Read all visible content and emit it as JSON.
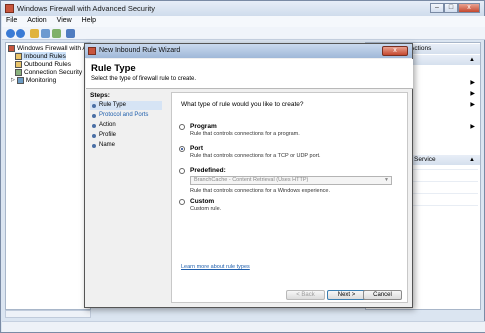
{
  "window": {
    "title": "Windows Firewall with Advanced Security",
    "minimize": "–",
    "maximize": "□",
    "close": "x"
  },
  "menubar": [
    "File",
    "Action",
    "View",
    "Help"
  ],
  "toolbar": [
    "back-icon",
    "forward-icon",
    "up-icon",
    "properties-icon",
    "refresh-icon",
    "help-icon"
  ],
  "tree": {
    "root": "Windows Firewall with Adva",
    "items": [
      "Inbound Rules",
      "Outbound Rules",
      "Connection Security Ru",
      "Monitoring"
    ]
  },
  "actions_pane": {
    "header": "Actions",
    "section2": "Service"
  },
  "wizard": {
    "title": "New Inbound Rule Wizard",
    "close": "x",
    "heading": "Rule Type",
    "subheading": "Select the type of firewall rule to create.",
    "steps_label": "Steps:",
    "steps": [
      {
        "label": "Rule Type",
        "state": "current"
      },
      {
        "label": "Protocol and Ports",
        "state": "next"
      },
      {
        "label": "Action",
        "state": "pending"
      },
      {
        "label": "Profile",
        "state": "pending"
      },
      {
        "label": "Name",
        "state": "pending"
      }
    ],
    "question": "What type of rule would you like to create?",
    "options": [
      {
        "label": "Program",
        "desc": "Rule that controls connections for a program.",
        "checked": false
      },
      {
        "label": "Port",
        "desc": "Rule that controls connections for a TCP or UDP port.",
        "checked": true
      },
      {
        "label": "Predefined:",
        "desc": "Rule that controls connections for a Windows experience.",
        "checked": false
      },
      {
        "label": "Custom",
        "desc": "Custom rule.",
        "checked": false
      }
    ],
    "predefined_select": "BranchCache - Content Retrieval (Uses HTTP)",
    "link": "Learn more about rule types",
    "buttons": {
      "back": "< Back",
      "next": "Next >",
      "cancel": "Cancel"
    }
  }
}
